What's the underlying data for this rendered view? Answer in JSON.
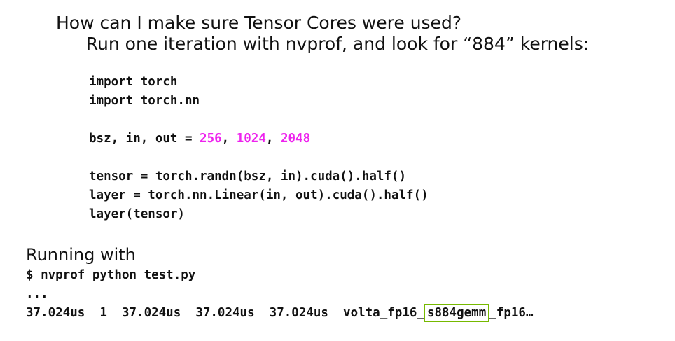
{
  "heading": {
    "line1": "How can I make sure Tensor Cores were used?",
    "line2": "Run one iteration with nvprof, and look for “884” kernels:"
  },
  "code": {
    "line1": "import torch",
    "line2": "import torch.nn",
    "line3_pre": "bsz, in, out = ",
    "line3_n1": "256",
    "line3_sep1": ", ",
    "line3_n2": "1024",
    "line3_sep2": ", ",
    "line3_n3": "2048",
    "line4": "tensor = torch.randn(bsz, in).cuda().half()",
    "line5": "layer = torch.nn.Linear(in, out).cuda().half()",
    "line6": "layer(tensor)"
  },
  "running": {
    "label": "Running with",
    "command": "$ nvprof python test.py",
    "ellipsis": "...",
    "output_pre": "37.024us  1  37.024us  37.024us  37.024us  volta_fp16",
    "output_highlight": "s884gemm",
    "output_post": "fp16…"
  },
  "colors": {
    "number_highlight": "#ee22ee",
    "kernel_box": "#76b900"
  }
}
